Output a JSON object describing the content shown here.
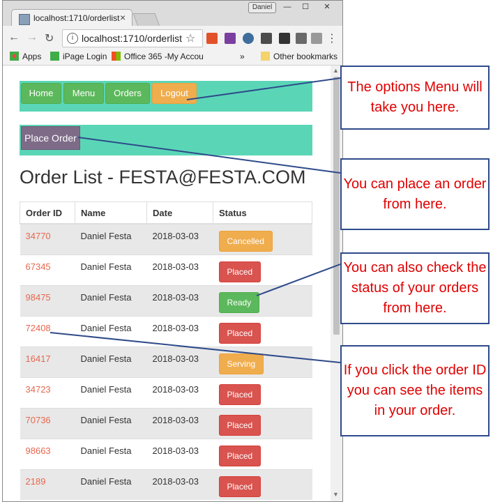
{
  "browser": {
    "tab_title": "localhost:1710/orderlist",
    "tab_close": "×",
    "user": "Daniel",
    "url": "localhost:1710/orderlist",
    "window_controls": {
      "min": "—",
      "max": "☐",
      "close": "✕"
    },
    "bookmarks": [
      {
        "label": "Apps",
        "icon": "apps-grid-icon"
      },
      {
        "label": "iPage Login",
        "icon": "ipage-icon"
      },
      {
        "label": "Office 365 -My Accou",
        "icon": "office-icon"
      },
      {
        "label": "»",
        "icon": ""
      },
      {
        "label": "Other bookmarks",
        "icon": "folder-icon"
      }
    ]
  },
  "nav": {
    "home": "Home",
    "menu": "Menu",
    "orders": "Orders",
    "logout": "Logout"
  },
  "place_order_label": "Place Order",
  "page_title": "Order List - FESTA@FESTA.COM",
  "table": {
    "headers": [
      "Order ID",
      "Name",
      "Date",
      "Status"
    ],
    "rows": [
      {
        "id": "34770",
        "name": "Daniel Festa",
        "date": "2018-03-03",
        "status": "Cancelled"
      },
      {
        "id": "67345",
        "name": "Daniel Festa",
        "date": "2018-03-03",
        "status": "Placed"
      },
      {
        "id": "98475",
        "name": "Daniel Festa",
        "date": "2018-03-03",
        "status": "Ready"
      },
      {
        "id": "72408",
        "name": "Daniel Festa",
        "date": "2018-03-03",
        "status": "Placed"
      },
      {
        "id": "16417",
        "name": "Daniel Festa",
        "date": "2018-03-03",
        "status": "Serving"
      },
      {
        "id": "34723",
        "name": "Daniel Festa",
        "date": "2018-03-03",
        "status": "Placed"
      },
      {
        "id": "70736",
        "name": "Daniel Festa",
        "date": "2018-03-03",
        "status": "Placed"
      },
      {
        "id": "98663",
        "name": "Daniel Festa",
        "date": "2018-03-03",
        "status": "Placed"
      },
      {
        "id": "2189",
        "name": "Daniel Festa",
        "date": "2018-03-03",
        "status": "Placed"
      }
    ]
  },
  "annotations": [
    "The options Menu will take you here.",
    "You can place an order from here.",
    "You can also check the status of your orders from here.",
    "If you click the order ID you can see the items in your order."
  ],
  "colors": {
    "navbar_bg": "#5ad6b7",
    "callout_border": "#2e4a8a",
    "callout_text": "#e00000",
    "link": "#e8674f"
  }
}
